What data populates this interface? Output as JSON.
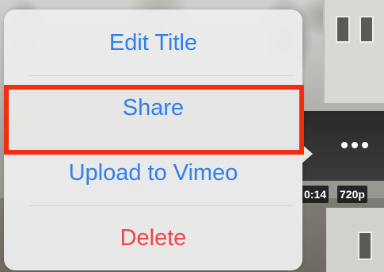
{
  "menu": {
    "items": [
      {
        "label": "Edit Title",
        "style": "default"
      },
      {
        "label": "Share",
        "style": "default",
        "highlighted": true
      },
      {
        "label": "Upload to Vimeo",
        "style": "default"
      },
      {
        "label": "Delete",
        "style": "destructive"
      }
    ]
  },
  "video": {
    "duration": "0:14",
    "quality": "720p"
  },
  "colors": {
    "action_blue": "#2f80ea",
    "destructive_red": "#f0434d",
    "highlight_red": "#f22d12",
    "menu_background": "#ebebeb"
  },
  "icons": {
    "more": "more-horizontal-icon"
  }
}
